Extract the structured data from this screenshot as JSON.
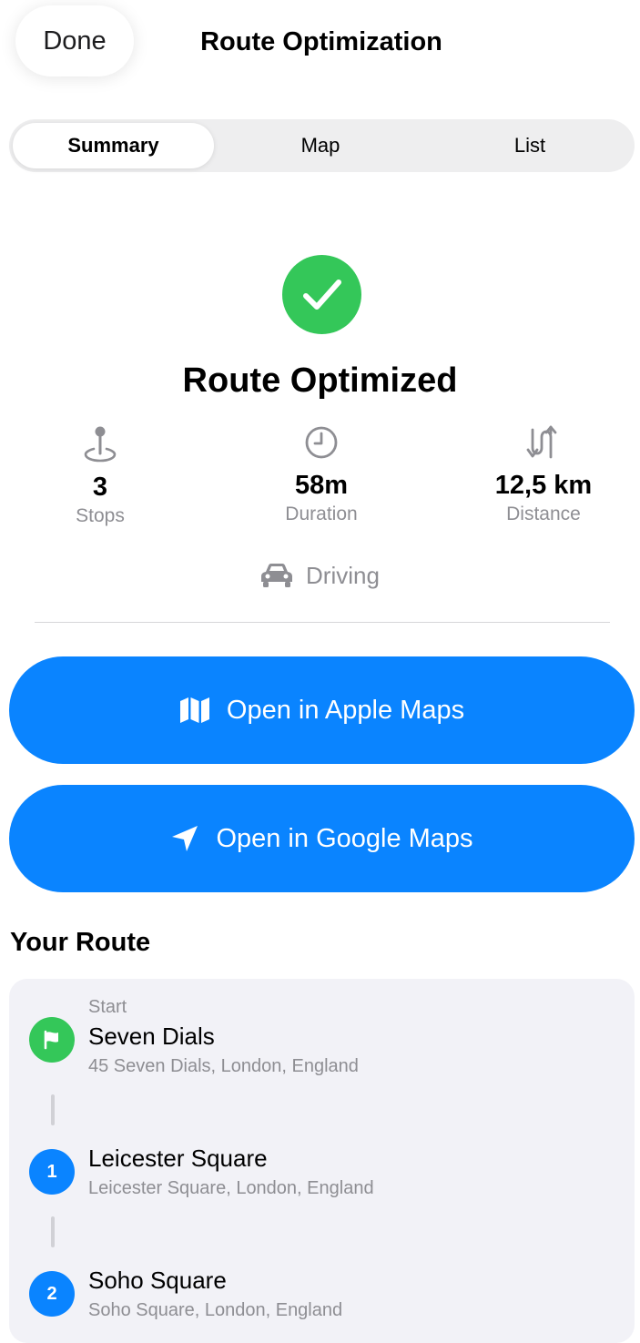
{
  "header": {
    "done_label": "Done",
    "title": "Route Optimization"
  },
  "tabs": [
    {
      "label": "Summary",
      "selected": true
    },
    {
      "label": "Map",
      "selected": false
    },
    {
      "label": "List",
      "selected": false
    }
  ],
  "summary": {
    "status_icon": "checkmark-circle-icon",
    "title": "Route Optimized",
    "stats": [
      {
        "icon": "mappin-icon",
        "value": "3",
        "label": "Stops"
      },
      {
        "icon": "clock-icon",
        "value": "58m",
        "label": "Duration"
      },
      {
        "icon": "route-arrows-icon",
        "value": "12,5 km",
        "label": "Distance"
      }
    ],
    "travel_mode": {
      "icon": "car-icon",
      "label": "Driving"
    }
  },
  "actions": {
    "apple_maps": {
      "icon": "map-icon",
      "label": "Open in Apple Maps"
    },
    "google_maps": {
      "icon": "location-arrow-icon",
      "label": "Open in Google Maps"
    }
  },
  "route": {
    "title": "Your Route",
    "stops": [
      {
        "marker": "flag-icon",
        "kicker": "Start",
        "name": "Seven Dials",
        "address": "45 Seven Dials, London, England"
      },
      {
        "marker": "1",
        "kicker": "",
        "name": "Leicester Square",
        "address": "Leicester Square, London, England"
      },
      {
        "marker": "2",
        "kicker": "",
        "name": "Soho Square",
        "address": "Soho Square, London, England"
      }
    ]
  },
  "colors": {
    "accent_blue": "#0a84ff",
    "success_green": "#34c759",
    "secondary_text": "#8e8e93",
    "card_background": "#f2f2f7"
  }
}
